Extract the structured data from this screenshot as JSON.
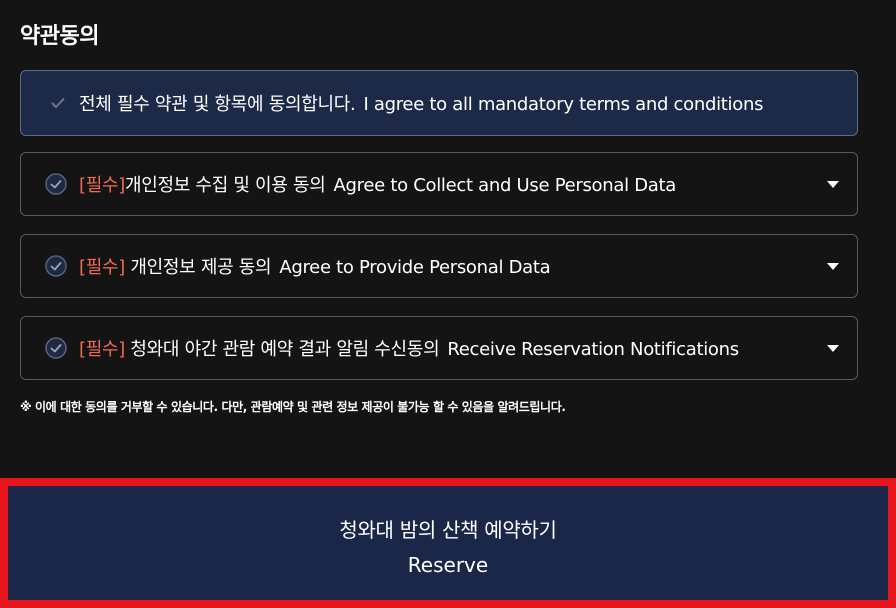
{
  "section": {
    "title": "약관동의"
  },
  "agree_all": {
    "label_ko": "전체 필수 약관 및 항목에 동의합니다.",
    "label_en": "I agree to all mandatory terms and conditions"
  },
  "terms": [
    {
      "required_tag": "[필수]",
      "label_ko": "개인정보 수집 및 이용 동의",
      "label_en": "Agree to Collect and Use Personal Data"
    },
    {
      "required_tag": "[필수]",
      "label_ko": " 개인정보 제공 동의",
      "label_en": "Agree to Provide Personal Data"
    },
    {
      "required_tag": "[필수]",
      "label_ko": " 청와대 야간 관람 예약 결과 알림 수신동의",
      "label_en": "Receive Reservation Notifications"
    }
  ],
  "notice": "※ 이에 대한 동의를 거부할 수 있습니다. 다만, 관람예약 및 관련 정보 제공이 불가능 할 수 있음을 알려드립니다.",
  "reserve_button": {
    "label_ko": "청와대 밤의 산책 예약하기",
    "label_en": "Reserve"
  },
  "colors": {
    "background": "#141414",
    "agree_all_bg": "#1c2a48",
    "required_tag": "#f06a53",
    "button_bg": "#1a2748",
    "highlight_outline": "#e8141c"
  },
  "icons": {
    "agree_all": "check-icon",
    "term": "check-circle-icon",
    "expand": "caret-down-icon"
  }
}
